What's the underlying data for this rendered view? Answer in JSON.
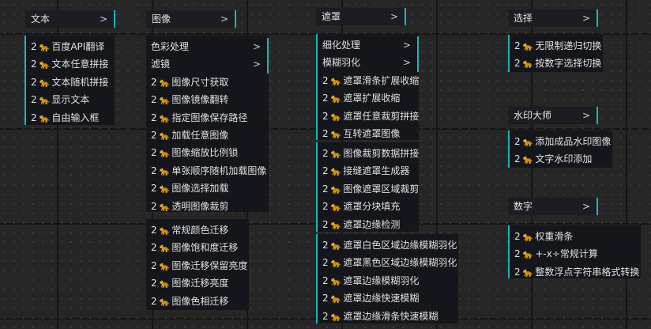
{
  "icon_glyph": "🐆",
  "colors": {
    "accent": "#18b8b8",
    "icon": "#e8922a",
    "panel": "#14161b",
    "header": "#1b1d22",
    "canvas": "#262626"
  },
  "headers": {
    "text": "文本",
    "image": "图像",
    "mask": "遮罩",
    "select": "选择",
    "watermark": "水印大师",
    "number": "数字"
  },
  "chevron": ">",
  "text_menu": {
    "items": [
      {
        "count": "2",
        "label": "百度API翻译"
      },
      {
        "count": "2",
        "label": "文本任意拼接"
      },
      {
        "count": "2",
        "label": "文本随机拼接"
      },
      {
        "count": "2",
        "label": "显示文本"
      },
      {
        "count": "2",
        "label": "自由输入框"
      }
    ]
  },
  "image_menu": {
    "submenus": [
      "色彩处理",
      "滤镜"
    ],
    "items": [
      {
        "count": "2",
        "label": "图像尺寸获取"
      },
      {
        "count": "2",
        "label": "图像镜像翻转"
      },
      {
        "count": "2",
        "label": "指定图像保存路径"
      },
      {
        "count": "2",
        "label": "加载任意图像"
      },
      {
        "count": "2",
        "label": "图像缩放比例锁"
      },
      {
        "count": "2",
        "label": "单张顺序随机加载图像"
      },
      {
        "count": "2",
        "label": "图像选择加载"
      },
      {
        "count": "2",
        "label": "透明图像裁剪"
      }
    ],
    "color_items": [
      {
        "count": "2",
        "label": "常规颜色迁移"
      },
      {
        "count": "2",
        "label": "图像饱和度迁移"
      },
      {
        "count": "2",
        "label": "图像迁移保留亮度"
      },
      {
        "count": "2",
        "label": "图像迁移亮度"
      },
      {
        "count": "2",
        "label": "图像色相迁移"
      }
    ]
  },
  "mask_menu": {
    "submenus": [
      "细化处理",
      "模糊羽化"
    ],
    "items": [
      {
        "count": "2",
        "label": "遮罩滑条扩展收缩"
      },
      {
        "count": "2",
        "label": "遮罩扩展收缩"
      },
      {
        "count": "2",
        "label": "遮罩任意裁剪拼接"
      },
      {
        "count": "2",
        "label": "互转遮罩图像"
      }
    ],
    "refine_items": [
      {
        "count": "2",
        "label": "图像裁剪数据拼接"
      },
      {
        "count": "2",
        "label": "接缝遮罩生成器"
      },
      {
        "count": "2",
        "label": "图像遮罩区域裁剪"
      },
      {
        "count": "2",
        "label": "遮罩分块填充"
      },
      {
        "count": "2",
        "label": "遮罩边缘检测"
      }
    ],
    "blur_items": [
      {
        "count": "2",
        "label": "遮罩白色区域边缘模糊羽化"
      },
      {
        "count": "2",
        "label": "遮罩黑色区域边缘模糊羽化"
      },
      {
        "count": "2",
        "label": "遮罩边缘模糊羽化"
      },
      {
        "count": "2",
        "label": "遮罩边缘快速模糊"
      },
      {
        "count": "2",
        "label": "遮罩边缘滑条快速模糊"
      }
    ]
  },
  "select_menu": {
    "items": [
      {
        "count": "2",
        "label": "无限制递归切换"
      },
      {
        "count": "2",
        "label": "按数字选择切换"
      }
    ]
  },
  "watermark_menu": {
    "items": [
      {
        "count": "2",
        "label": "添加成品水印图像"
      },
      {
        "count": "2",
        "label": "文字水印添加"
      }
    ]
  },
  "number_menu": {
    "items": [
      {
        "count": "2",
        "label": "权重滑条"
      },
      {
        "count": "2",
        "label": "+-x÷常规计算"
      },
      {
        "count": "2",
        "label": "整数浮点字符串格式转换"
      }
    ]
  }
}
